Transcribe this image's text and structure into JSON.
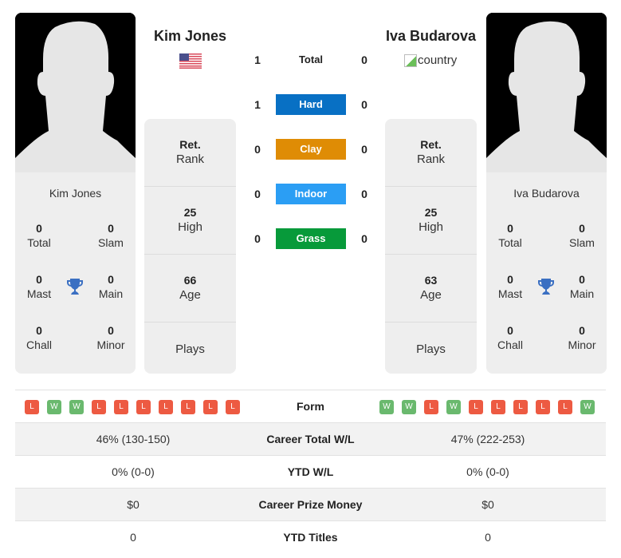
{
  "players": {
    "left": {
      "name": "Kim Jones",
      "country_flag": "us-flag-icon",
      "titles": {
        "total": {
          "value": "0",
          "label": "Total"
        },
        "slam": {
          "value": "0",
          "label": "Slam"
        },
        "mast": {
          "value": "0",
          "label": "Mast"
        },
        "main": {
          "value": "0",
          "label": "Main"
        },
        "chall": {
          "value": "0",
          "label": "Chall"
        },
        "minor": {
          "value": "0",
          "label": "Minor"
        }
      },
      "rank": {
        "value": "Ret.",
        "label": "Rank"
      },
      "high": {
        "value": "25",
        "label": "High"
      },
      "age": {
        "value": "66",
        "label": "Age"
      },
      "plays": {
        "value": "",
        "label": "Plays"
      },
      "form": [
        "L",
        "W",
        "W",
        "L",
        "L",
        "L",
        "L",
        "L",
        "L",
        "L"
      ]
    },
    "right": {
      "name": "Iva Budarova",
      "country_alt": "country",
      "titles": {
        "total": {
          "value": "0",
          "label": "Total"
        },
        "slam": {
          "value": "0",
          "label": "Slam"
        },
        "mast": {
          "value": "0",
          "label": "Mast"
        },
        "main": {
          "value": "0",
          "label": "Main"
        },
        "chall": {
          "value": "0",
          "label": "Chall"
        },
        "minor": {
          "value": "0",
          "label": "Minor"
        }
      },
      "rank": {
        "value": "Ret.",
        "label": "Rank"
      },
      "high": {
        "value": "25",
        "label": "High"
      },
      "age": {
        "value": "63",
        "label": "Age"
      },
      "plays": {
        "value": "",
        "label": "Plays"
      },
      "form": [
        "W",
        "W",
        "L",
        "W",
        "L",
        "L",
        "L",
        "L",
        "L",
        "W"
      ]
    }
  },
  "h2h": [
    {
      "label": "Total",
      "left": "1",
      "right": "0",
      "color": null
    },
    {
      "label": "Hard",
      "left": "1",
      "right": "0",
      "color": "#0870c4"
    },
    {
      "label": "Clay",
      "left": "0",
      "right": "0",
      "color": "#df8c05"
    },
    {
      "label": "Indoor",
      "left": "0",
      "right": "0",
      "color": "#2b9ef4"
    },
    {
      "label": "Grass",
      "left": "0",
      "right": "0",
      "color": "#079a3a"
    }
  ],
  "stats": {
    "form_label": "Form",
    "rows": [
      {
        "label": "Career Total W/L",
        "left": "46% (130-150)",
        "right": "47% (222-253)"
      },
      {
        "label": "YTD W/L",
        "left": "0% (0-0)",
        "right": "0% (0-0)"
      },
      {
        "label": "Career Prize Money",
        "left": "$0",
        "right": "$0"
      },
      {
        "label": "YTD Titles",
        "left": "0",
        "right": "0"
      }
    ]
  },
  "colors": {
    "win": "#6ab96e",
    "loss": "#ed5a42",
    "trophy": "#3a6fc2"
  }
}
